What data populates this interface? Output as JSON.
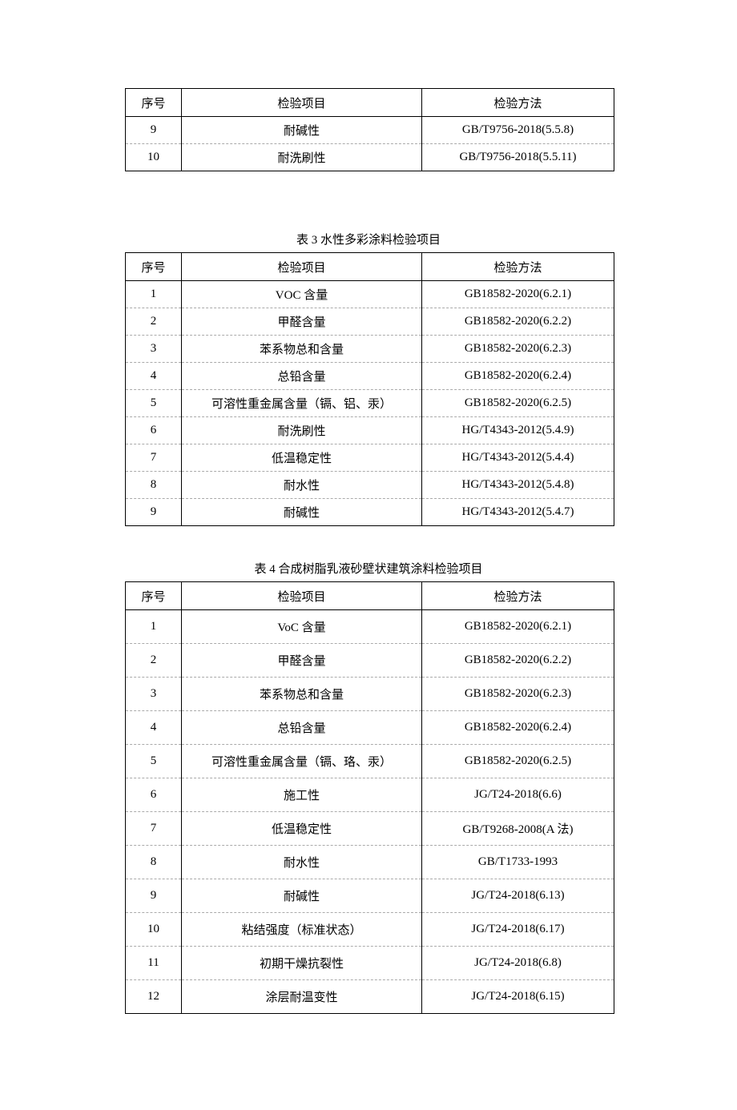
{
  "headers": {
    "seq": "序号",
    "item": "检验项目",
    "method": "检验方法"
  },
  "table_top": {
    "rows": [
      {
        "seq": "9",
        "item": "耐碱性",
        "method": "GB/T9756-2018(5.5.8)"
      },
      {
        "seq": "10",
        "item": "耐洗刷性",
        "method": "GB/T9756-2018(5.5.11)"
      }
    ]
  },
  "table3": {
    "caption": "表 3 水性多彩涂料检验项目",
    "rows": [
      {
        "seq": "1",
        "item": "VOC 含量",
        "method": "GB18582-2020(6.2.1)"
      },
      {
        "seq": "2",
        "item": "甲醛含量",
        "method": "GB18582-2020(6.2.2)"
      },
      {
        "seq": "3",
        "item": "苯系物总和含量",
        "method": "GB18582-2020(6.2.3)"
      },
      {
        "seq": "4",
        "item": "总铅含量",
        "method": "GB18582-2020(6.2.4)"
      },
      {
        "seq": "5",
        "item": "可溶性重金属含量（镉、铝、汞）",
        "method": "GB18582-2020(6.2.5)"
      },
      {
        "seq": "6",
        "item": "耐洗刷性",
        "method": "HG/T4343-2012(5.4.9)"
      },
      {
        "seq": "7",
        "item": "低温稳定性",
        "method": "HG/T4343-2012(5.4.4)"
      },
      {
        "seq": "8",
        "item": "耐水性",
        "method": "HG/T4343-2012(5.4.8)"
      },
      {
        "seq": "9",
        "item": "耐碱性",
        "method": "HG/T4343-2012(5.4.7)"
      }
    ]
  },
  "table4": {
    "caption": "表 4 合成树脂乳液砂壁状建筑涂料检验项目",
    "rows": [
      {
        "seq": "1",
        "item": "VoC 含量",
        "method": "GB18582-2020(6.2.1)"
      },
      {
        "seq": "2",
        "item": "甲醛含量",
        "method": "GB18582-2020(6.2.2)"
      },
      {
        "seq": "3",
        "item": "苯系物总和含量",
        "method": "GB18582-2020(6.2.3)"
      },
      {
        "seq": "4",
        "item": "总铅含量",
        "method": "GB18582-2020(6.2.4)"
      },
      {
        "seq": "5",
        "item": "可溶性重金属含量（镉、珞、汞）",
        "method": "GB18582-2020(6.2.5)"
      },
      {
        "seq": "6",
        "item": "施工性",
        "method": "JG/T24-2018(6.6)"
      },
      {
        "seq": "7",
        "item": "低温稳定性",
        "method": "GB/T9268-2008(A 法)"
      },
      {
        "seq": "8",
        "item": "耐水性",
        "method": "GB/T1733-1993"
      },
      {
        "seq": "9",
        "item": "耐碱性",
        "method": "JG/T24-2018(6.13)"
      },
      {
        "seq": "10",
        "item": "粘结强度（标准状态）",
        "method": "JG/T24-2018(6.17)"
      },
      {
        "seq": "11",
        "item": "初期干燥抗裂性",
        "method": "JG/T24-2018(6.8)"
      },
      {
        "seq": "12",
        "item": "涂层耐温变性",
        "method": "JG/T24-2018(6.15)"
      }
    ]
  }
}
